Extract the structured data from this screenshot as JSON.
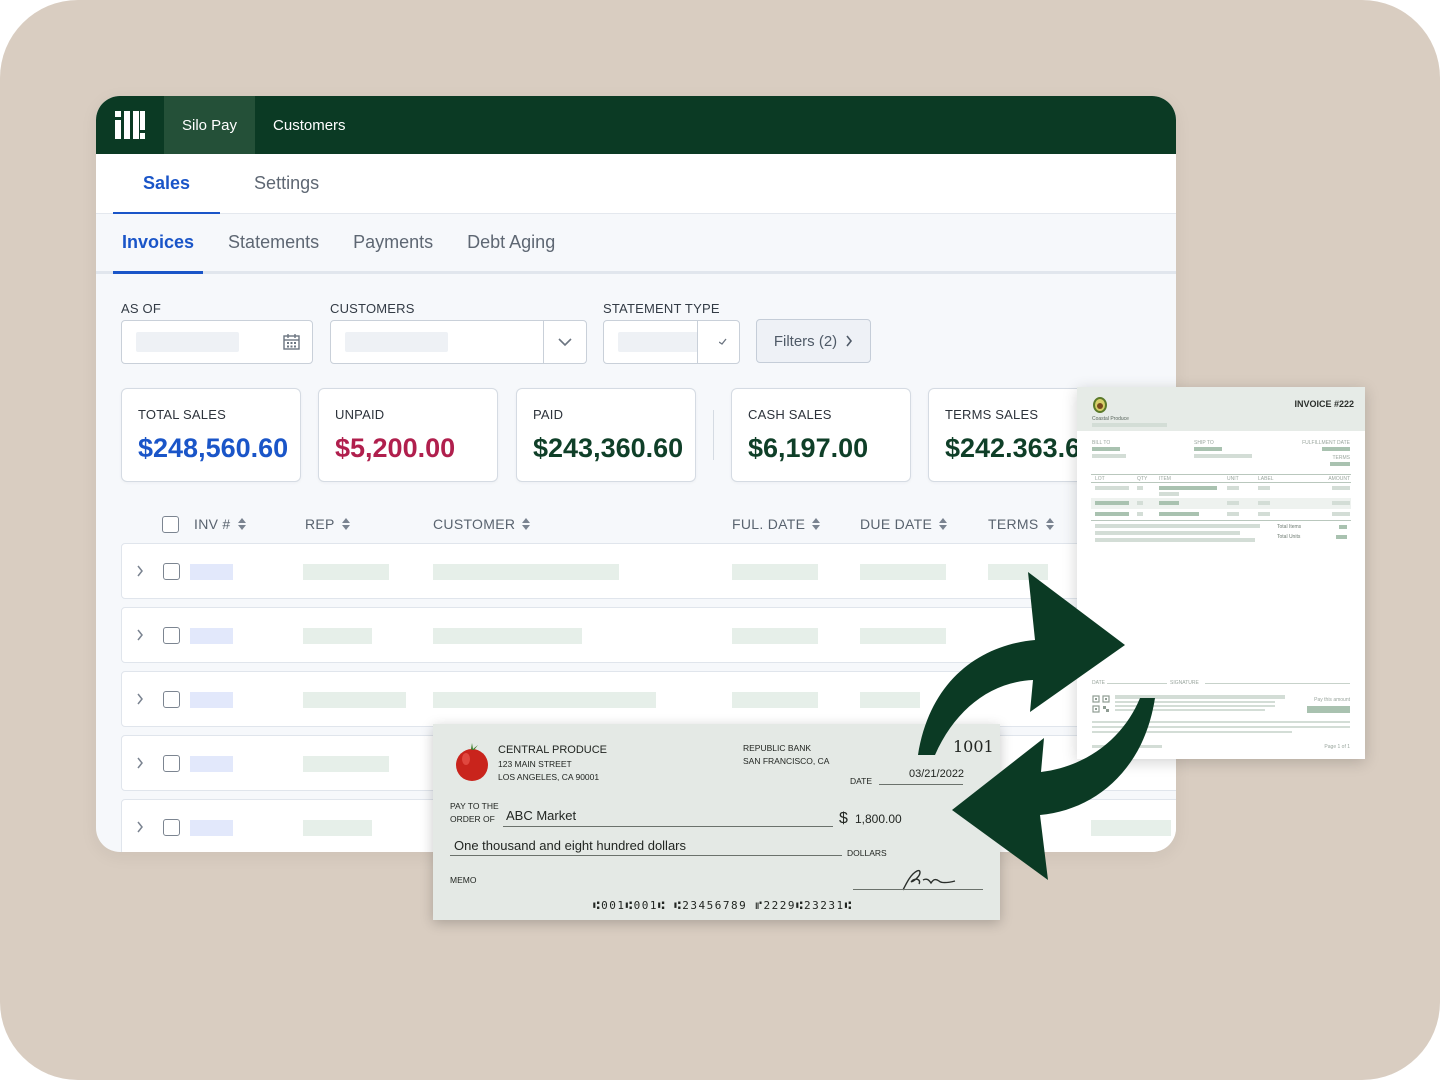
{
  "nav": {
    "items": [
      {
        "label": "Silo Pay"
      },
      {
        "label": "Customers"
      }
    ]
  },
  "tabs_primary": [
    {
      "label": "Sales"
    },
    {
      "label": "Settings"
    }
  ],
  "tabs_secondary": [
    {
      "label": "Invoices"
    },
    {
      "label": "Statements"
    },
    {
      "label": "Payments"
    },
    {
      "label": "Debt Aging"
    }
  ],
  "filters": {
    "as_of_label": "AS OF",
    "customers_label": "CUSTOMERS",
    "statement_type_label": "STATEMENT TYPE",
    "filters_button": "Filters (2)"
  },
  "summary": [
    {
      "label": "TOTAL SALES",
      "value": "$248,560.60",
      "color": "#1a55c8"
    },
    {
      "label": "UNPAID",
      "value": "$5,200.00",
      "color": "#b01f4d"
    },
    {
      "label": "PAID",
      "value": "$243,360.60",
      "color": "#0f3f28"
    },
    {
      "label": "CASH SALES",
      "value": "$6,197.00",
      "color": "#0f3f28"
    },
    {
      "label": "TERMS SALES",
      "value": "$242.363.6",
      "color": "#0f3f28"
    }
  ],
  "table": {
    "headers": [
      {
        "label": "INV #"
      },
      {
        "label": "REP"
      },
      {
        "label": "CUSTOMER"
      },
      {
        "label": "FUL. DATE"
      },
      {
        "label": "DUE DATE"
      },
      {
        "label": "TERMS"
      }
    ]
  },
  "invoice": {
    "title": "INVOICE #222",
    "company": "Coastal Produce",
    "bill_to": "BILL TO",
    "ship_to": "SHIP TO",
    "fulfillment_date": "FULFILLMENT DATE",
    "terms": "TERMS",
    "col_lot": "LOT",
    "col_qty": "QTY",
    "col_item": "ITEM",
    "col_unit": "UNIT",
    "col_label": "LABEL",
    "col_amount": "AMOUNT",
    "total_items": "Total Items",
    "total_units": "Total Units",
    "date": "DATE",
    "signature": "SIGNATURE",
    "pay_amount": "Pay this amount",
    "page": "Page 1 of 1"
  },
  "check": {
    "payer_name": "CENTRAL PRODUCE",
    "payer_street": "123 MAIN STREET",
    "payer_city": "LOS ANGELES, CA 90001",
    "bank_name": "REPUBLIC BANK",
    "bank_city": "SAN FRANCISCO, CA",
    "number": "1001",
    "date_label": "DATE",
    "date": "03/21/2022",
    "pay_to_label_1": "PAY TO THE",
    "pay_to_label_2": "ORDER OF",
    "payee": "ABC Market",
    "currency": "$",
    "amount": "1,800.00",
    "amount_words": "One thousand and eight hundred dollars",
    "dollars_label": "DOLLARS",
    "memo_label": "MEMO",
    "micr": "⑆001⑆001⑆ ⑆23456789 ⑈2229⑆23231⑆"
  },
  "colors": {
    "brand_dark": "#0b3a24",
    "accent_blue": "#1a55c8",
    "background": "#d9cdc1"
  }
}
